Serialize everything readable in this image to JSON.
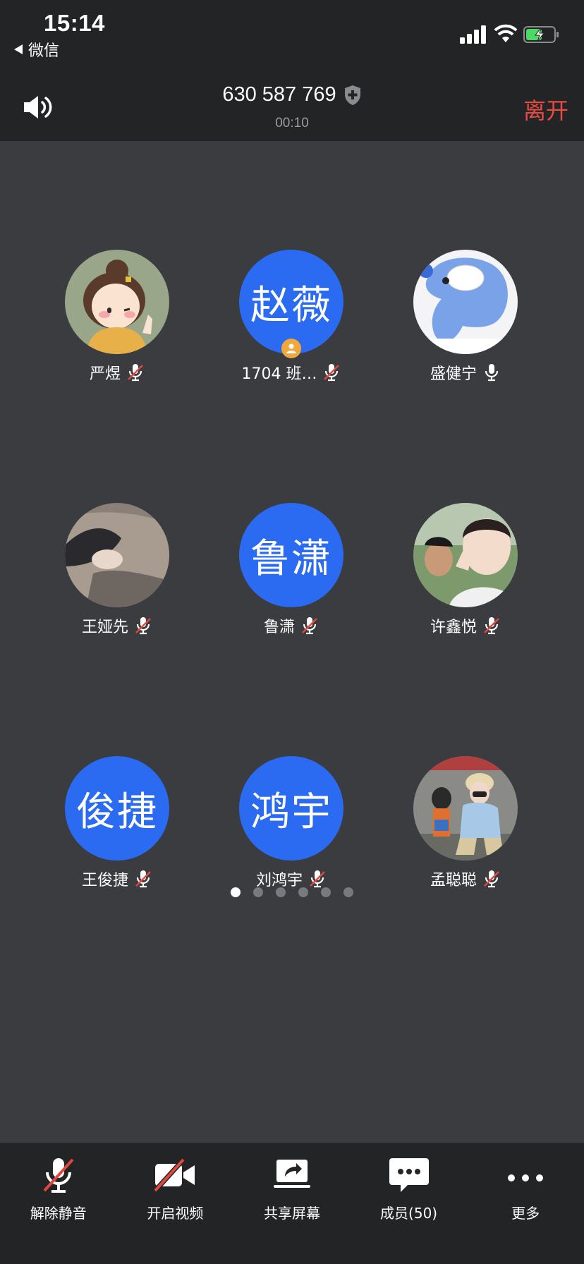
{
  "status_bar": {
    "time": "15:14",
    "back_app": "微信"
  },
  "header": {
    "meeting_id": "630 587 769",
    "timer": "00:10",
    "leave_label": "离开"
  },
  "participants": [
    {
      "name": "严煜",
      "avatar_type": "photo",
      "mic": "muted"
    },
    {
      "name": "1704 班…",
      "avatar_type": "text",
      "avatar_text": "赵薇",
      "mic": "muted",
      "host": true
    },
    {
      "name": "盛健宁",
      "avatar_type": "photo",
      "mic": "on"
    },
    {
      "name": "王娅先",
      "avatar_type": "photo",
      "mic": "muted"
    },
    {
      "name": "鲁潇",
      "avatar_type": "text",
      "avatar_text": "鲁潇",
      "mic": "muted"
    },
    {
      "name": "许鑫悦",
      "avatar_type": "photo",
      "mic": "muted"
    },
    {
      "name": "王俊捷",
      "avatar_type": "text",
      "avatar_text": "俊捷",
      "mic": "muted"
    },
    {
      "name": "刘鸿宇",
      "avatar_type": "text",
      "avatar_text": "鸿宇",
      "mic": "muted"
    },
    {
      "name": "孟聪聪",
      "avatar_type": "photo",
      "mic": "muted"
    }
  ],
  "pagination": {
    "pages": 6,
    "current": 1
  },
  "toolbar": {
    "unmute_label": "解除静音",
    "video_label": "开启视频",
    "share_label": "共享屏幕",
    "members_label": "成员(50)",
    "more_label": "更多"
  },
  "colors": {
    "accent_blue": "#2b6bf2",
    "leave_red": "#e94b42",
    "mute_red": "#e0483f",
    "host_badge": "#f0a83a"
  }
}
